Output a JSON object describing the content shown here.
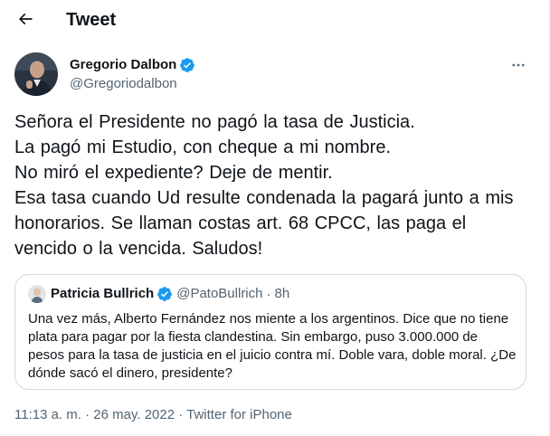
{
  "header": {
    "title": "Tweet"
  },
  "tweet": {
    "author_name": "Gregorio Dalbon",
    "author_handle": "@Gregoriodalbon",
    "text": "Señora el Presidente no pagó la tasa de Justicia.\nLa pagó mi Estudio, con cheque a mi nombre.\nNo miró el expediente? Deje de mentir.\nEsa tasa cuando Ud resulte condenada la pagará junto a mis honorarios. Se llaman costas art. 68 CPCC, las paga el vencido o la vencida. Saludos!",
    "time": "11:13 a. m.",
    "date": "26 may. 2022",
    "source": "Twitter for iPhone",
    "separator": "·"
  },
  "quote": {
    "author_name": "Patricia Bullrich",
    "author_handle": "@PatoBullrich",
    "separator": "·",
    "time": "8h",
    "text": "Una vez más, Alberto Fernández nos miente a los argentinos. Dice que no tiene plata para pagar por la fiesta clandestina. Sin embargo, puso 3.000.000 de pesos para la tasa de justicia en el juicio contra mí. Doble vara, doble moral. ¿De dónde sacó el dinero, presidente?"
  },
  "icons": {
    "back": "arrow-left-icon",
    "verified": "verified-badge-icon",
    "more": "more-horizontal-icon"
  },
  "colors": {
    "text_primary": "#0f1419",
    "text_secondary": "#536471",
    "verified_blue": "#1d9bf0",
    "border": "#cfd9de"
  }
}
